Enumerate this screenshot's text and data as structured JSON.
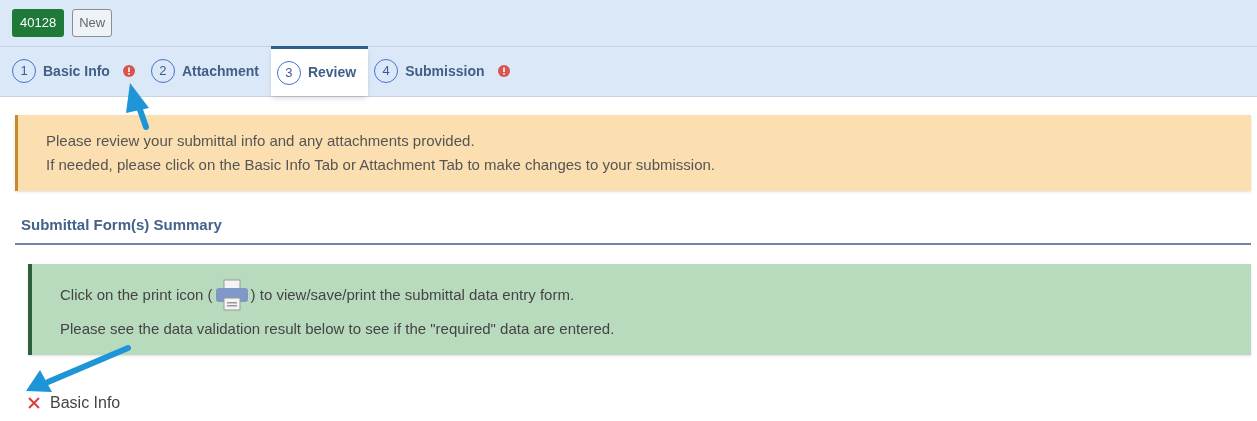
{
  "record": {
    "id": "40128",
    "status": "New"
  },
  "tabs": [
    {
      "number": "1",
      "label": "Basic Info",
      "selected": false,
      "error": true
    },
    {
      "number": "2",
      "label": "Attachment",
      "selected": false,
      "error": false
    },
    {
      "number": "3",
      "label": "Review",
      "selected": true,
      "error": false
    },
    {
      "number": "4",
      "label": "Submission",
      "selected": false,
      "error": true
    }
  ],
  "notice": {
    "lines": [
      "Please review your submittal info and any attachments provided.",
      "If needed, please click on the Basic Info Tab or Attachment Tab to make changes to your submission."
    ]
  },
  "section_title": "Submittal Form(s) Summary",
  "info": {
    "before_icon": "Click on the print icon (",
    "after_icon": ") to view/save/print the submittal data entry form.",
    "line_2": "Please see the data validation result below to see if the \"required\" data are entered."
  },
  "validation": [
    {
      "label": "Basic Info",
      "valid": false
    }
  ]
}
